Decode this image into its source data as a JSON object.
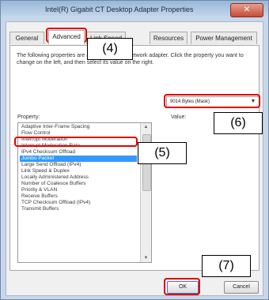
{
  "window": {
    "title": "Intel(R) Gigabit CT Desktop Adapter Properties",
    "close_label": "✕"
  },
  "tabs": [
    {
      "label": "General"
    },
    {
      "label": "Advanced"
    },
    {
      "label": "Link Speed"
    },
    {
      "label": "Resources"
    },
    {
      "label": "Power Management"
    }
  ],
  "panel": {
    "description": "The following properties are available for this network adapter. Click the property you want to change on the left, and then select its value on the right.",
    "property_label": "Property:",
    "value_label": "Value:"
  },
  "properties": [
    "Adaptive Inter-Frame Spacing",
    "Flow Control",
    "Interrupt Moderation",
    "Interrupt Moderation Rate",
    "IPv4 Checksum Offload",
    "Jumbo Packet",
    "Large Send Offload (IPv4)",
    "Link Speed & Duplex",
    "Locally Administered Address",
    "Number of Coalesce Buffers",
    "Priority & VLAN",
    "Receive Buffers",
    "TCP Checksum Offload (IPv4)",
    "Transmit Buffers"
  ],
  "selected_property": "Jumbo Packet",
  "value": {
    "selected": "9014 Bytes (Mask)",
    "arrow": "▼"
  },
  "buttons": {
    "ok": "OK",
    "cancel": "Cancel"
  },
  "annotations": {
    "a4": "(4)",
    "a5": "(5)",
    "a6": "(6)",
    "a7": "(7)"
  },
  "colors": {
    "selection": "#3399ff",
    "highlight": "#e00000"
  }
}
